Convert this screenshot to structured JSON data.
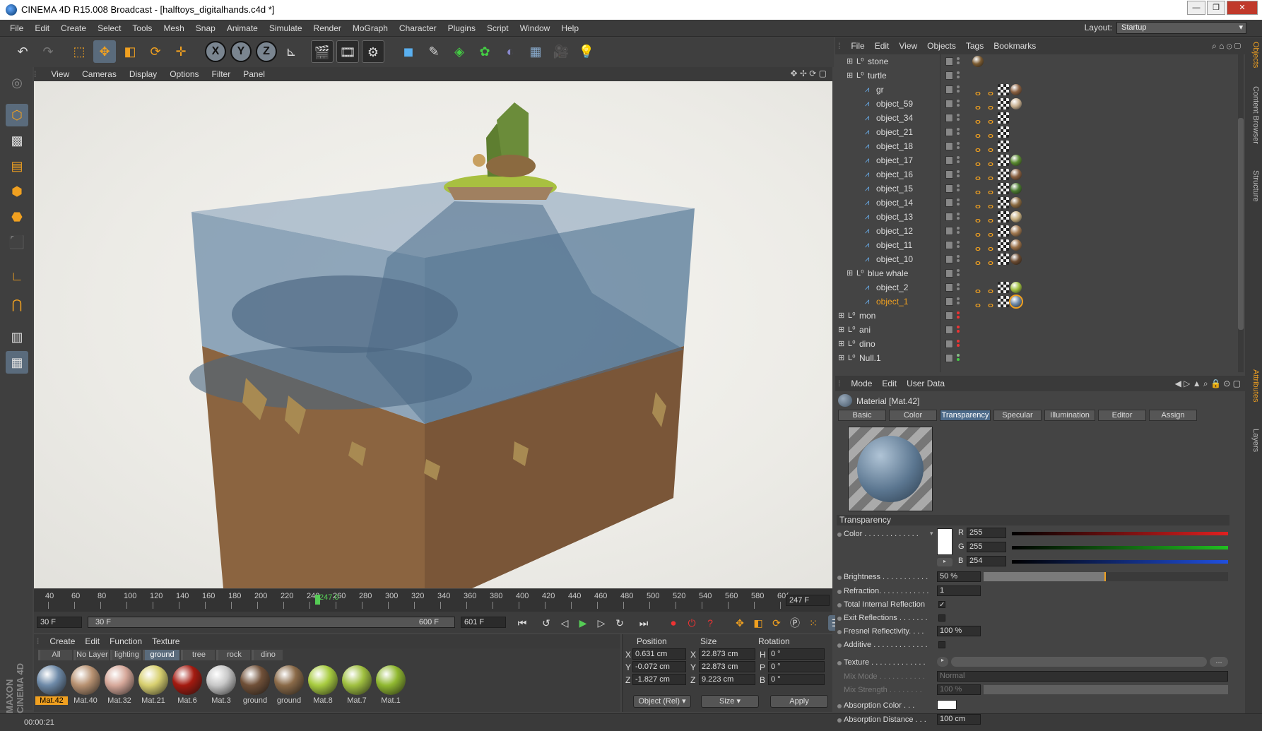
{
  "titlebar": {
    "title": "CINEMA 4D R15.008 Broadcast - [halftoys_digitalhands.c4d *]"
  },
  "menu": [
    "File",
    "Edit",
    "Create",
    "Select",
    "Tools",
    "Mesh",
    "Snap",
    "Animate",
    "Simulate",
    "Render",
    "MoGraph",
    "Character",
    "Plugins",
    "Script",
    "Window",
    "Help"
  ],
  "layout": {
    "label": "Layout:",
    "value": "Startup"
  },
  "viewport_menu": [
    "View",
    "Cameras",
    "Display",
    "Options",
    "Filter",
    "Panel"
  ],
  "timeline": {
    "ticks": [
      "40",
      "60",
      "80",
      "100",
      "120",
      "140",
      "160",
      "180",
      "200",
      "220",
      "240",
      "260",
      "280",
      "300",
      "320",
      "340",
      "360",
      "380",
      "400",
      "420",
      "440",
      "460",
      "480",
      "500",
      "520",
      "540",
      "560",
      "580",
      "60("
    ],
    "current_marker": "247.0",
    "current_frame": "247 F",
    "start": "30 F",
    "range_start": "30 F",
    "range_end": "600 F",
    "end": "601 F"
  },
  "material_menu": [
    "Create",
    "Edit",
    "Function",
    "Texture"
  ],
  "material_filters": [
    "All",
    "No Layer",
    "lighting",
    "ground",
    "tree",
    "rock",
    "dino"
  ],
  "material_filter_selected": "ground",
  "materials": [
    {
      "name": "Mat.42",
      "color": "#6e8aa8",
      "selected": true
    },
    {
      "name": "Mat.40",
      "color": "#b89272"
    },
    {
      "name": "Mat.32",
      "color": "#d6a89a"
    },
    {
      "name": "Mat.21",
      "color": "#d8d070"
    },
    {
      "name": "Mat.6",
      "color": "#a41a10"
    },
    {
      "name": "Mat.3",
      "color": "#c8c8c8"
    },
    {
      "name": "ground",
      "color": "#705038"
    },
    {
      "name": "ground",
      "color": "#8a6a48"
    },
    {
      "name": "Mat.8",
      "color": "#a8cc40"
    },
    {
      "name": "Mat.7",
      "color": "#a0c040"
    },
    {
      "name": "Mat.1",
      "color": "#90b830"
    }
  ],
  "coords": {
    "headers": {
      "position": "Position",
      "size": "Size",
      "rotation": "Rotation"
    },
    "rows": [
      {
        "axis": "X",
        "pos": "0.631 cm",
        "size_axis": "X",
        "size": "22.873 cm",
        "rot_axis": "H",
        "rot": "0 °"
      },
      {
        "axis": "Y",
        "pos": "-0.072 cm",
        "size_axis": "Y",
        "size": "22.873 cm",
        "rot_axis": "P",
        "rot": "0 °"
      },
      {
        "axis": "Z",
        "pos": "-1.827 cm",
        "size_axis": "Z",
        "size": "9.223 cm",
        "rot_axis": "B",
        "rot": "0 °"
      }
    ],
    "mode": "Object (Rel)",
    "size_mode": "Size",
    "apply": "Apply"
  },
  "objects_menu": [
    "File",
    "Edit",
    "View",
    "Objects",
    "Tags",
    "Bookmarks"
  ],
  "objects": [
    {
      "name": "stone",
      "type": "null",
      "depth": 1,
      "expand": true,
      "tags": [
        "#7a5a30"
      ]
    },
    {
      "name": "turtle",
      "type": "null",
      "depth": 1,
      "expand": true,
      "tags": []
    },
    {
      "name": "gr",
      "type": "poly",
      "depth": 2,
      "tags": [
        "phong",
        "phong",
        "check",
        "#8a6040"
      ]
    },
    {
      "name": "object_59",
      "type": "poly",
      "depth": 2,
      "tags": [
        "phong",
        "phong",
        "check",
        "#c8b090"
      ]
    },
    {
      "name": "object_34",
      "type": "poly",
      "depth": 2,
      "tags": [
        "phong",
        "phong",
        "check"
      ]
    },
    {
      "name": "object_21",
      "type": "poly",
      "depth": 2,
      "tags": [
        "phong",
        "phong",
        "check"
      ]
    },
    {
      "name": "object_18",
      "type": "poly",
      "depth": 2,
      "tags": [
        "phong",
        "phong",
        "check"
      ]
    },
    {
      "name": "object_17",
      "type": "poly",
      "depth": 2,
      "tags": [
        "phong",
        "phong",
        "check",
        "#5a8a30"
      ]
    },
    {
      "name": "object_16",
      "type": "poly",
      "depth": 2,
      "tags": [
        "phong",
        "phong",
        "check",
        "#8a6040"
      ]
    },
    {
      "name": "object_15",
      "type": "poly",
      "depth": 2,
      "tags": [
        "phong",
        "phong",
        "check",
        "#4a7a30"
      ]
    },
    {
      "name": "object_14",
      "type": "poly",
      "depth": 2,
      "tags": [
        "phong",
        "phong",
        "check",
        "#8a6a40"
      ]
    },
    {
      "name": "object_13",
      "type": "poly",
      "depth": 2,
      "tags": [
        "phong",
        "phong",
        "check",
        "#c8b080"
      ]
    },
    {
      "name": "object_12",
      "type": "poly",
      "depth": 2,
      "tags": [
        "phong",
        "phong",
        "check",
        "#a07850"
      ]
    },
    {
      "name": "object_11",
      "type": "poly",
      "depth": 2,
      "tags": [
        "phong",
        "phong",
        "check",
        "#9a7048"
      ]
    },
    {
      "name": "object_10",
      "type": "poly",
      "depth": 2,
      "tags": [
        "phong",
        "phong",
        "check",
        "#6a4a30"
      ]
    },
    {
      "name": "blue whale",
      "type": "null",
      "depth": 1,
      "expand": true,
      "tags": []
    },
    {
      "name": "object_2",
      "type": "poly",
      "depth": 2,
      "tags": [
        "phong",
        "phong",
        "check",
        "#a0c040"
      ]
    },
    {
      "name": "object_1",
      "type": "poly",
      "depth": 2,
      "selected": true,
      "tags": [
        "phong",
        "phong",
        "check",
        "#6e8aa8"
      ]
    },
    {
      "name": "mon",
      "type": "null",
      "depth": 0,
      "expand": true,
      "tags": [],
      "red": true
    },
    {
      "name": "ani",
      "type": "null",
      "depth": 0,
      "expand": true,
      "tags": [],
      "red": true
    },
    {
      "name": "dino",
      "type": "null",
      "depth": 0,
      "expand": true,
      "tags": [],
      "red": true
    },
    {
      "name": "Null.1",
      "type": "null",
      "depth": 0,
      "expand": true,
      "tags": [],
      "green": true
    }
  ],
  "attr_menu": [
    "Mode",
    "Edit",
    "User Data"
  ],
  "attr": {
    "material_title": "Material [Mat.42]",
    "tabs": [
      "Basic",
      "Color",
      "Transparency",
      "Specular",
      "Illumination",
      "Editor",
      "Assign"
    ],
    "selected_tab": "Transparency",
    "section": "Transparency",
    "color_label": "Color . . . . . . . . . . . . .",
    "r_label": "R",
    "r": "255",
    "g_label": "G",
    "g": "255",
    "b_label": "B",
    "b": "254",
    "brightness_label": "Brightness . . . . . . . . . . .",
    "brightness": "50 %",
    "brightness_level": 0.5,
    "refraction_label": "Refraction. . . . . . . . . . . .",
    "refraction": "1",
    "tir_label": "Total Internal Reflection",
    "tir_check": "✓",
    "exit_label": "Exit Reflections . . . . . . .",
    "fresnel_label": "Fresnel Reflectivity. . . .",
    "fresnel": "100 %",
    "additive_label": "Additive . . . . . . . . . . . . .",
    "texture_label": "Texture . . . . . . . . . . . . .",
    "texture_btn": "...",
    "mixmode_label": "Mix Mode . . . . . . . . . . .",
    "mixmode": "Normal",
    "mixstrength_label": "Mix Strength . . . . . . . .",
    "mixstrength": "100 %",
    "absorb_color_label": "Absorption Color . . .",
    "absorb_dist_label": "Absorption Distance . . .",
    "absorb_dist": "100 cm"
  },
  "right_tabs": [
    "Objects",
    "Content Browser",
    "Structure"
  ],
  "right_tabs2": [
    "Attributes",
    "Layers"
  ],
  "status": "00:00:21",
  "maxon": "MAXON CINEMA 4D"
}
